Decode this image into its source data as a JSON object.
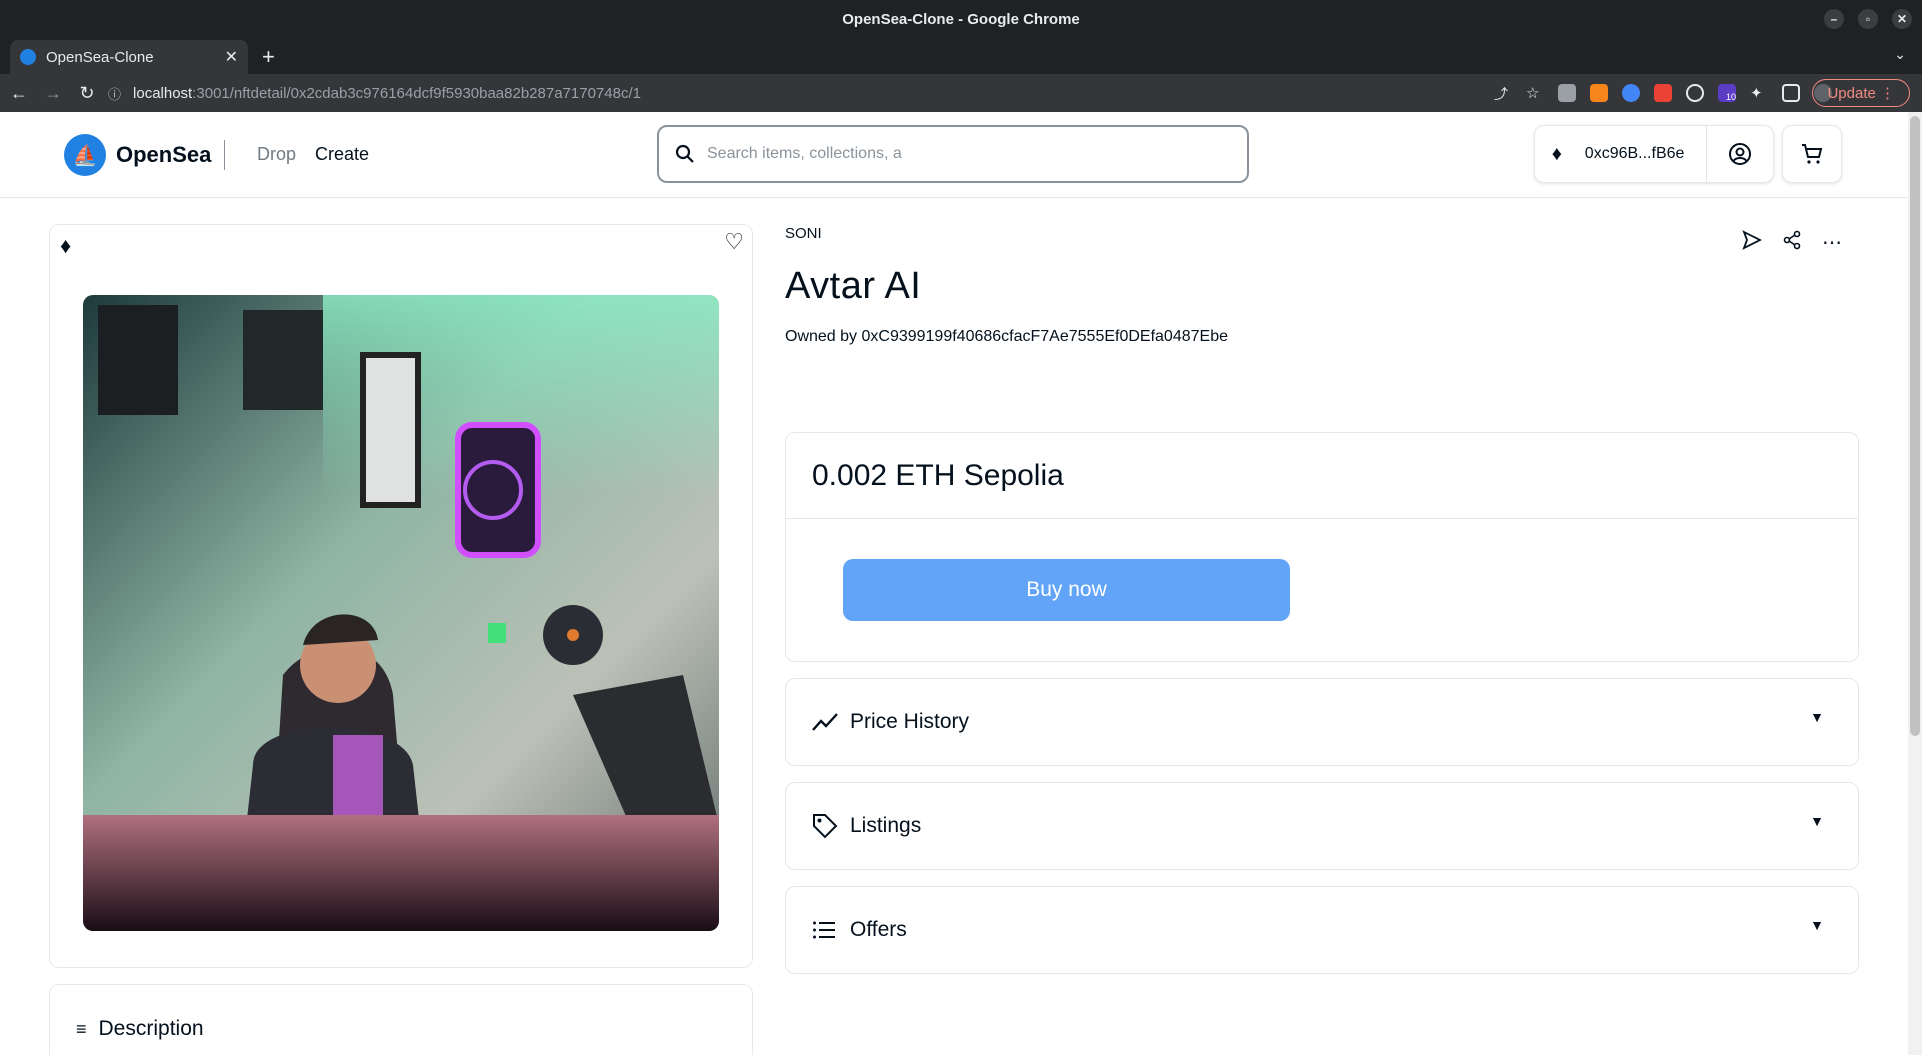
{
  "browser": {
    "window_title": "OpenSea-Clone - Google Chrome",
    "tab_title": "OpenSea-Clone",
    "url_host": "localhost",
    "url_path": ":3001/nftdetail/0x2cdab3c976164dcf9f5930baa82b287a7170748c/1",
    "update_label": "Update",
    "extension_badge": "10"
  },
  "header": {
    "logo_text": "OpenSea",
    "nav": {
      "drop": "Drop",
      "create": "Create"
    },
    "search_placeholder": "Search items, collections, a",
    "wallet_address": "0xc96B...fB6e"
  },
  "nft": {
    "collection": "SONI",
    "title": "Avtar AI",
    "owned_by": "Owned by 0xC9399199f40686cfacF7Ae7555Ef0DEfa0487Ebe",
    "price": "0.002 ETH Sepolia",
    "buy_label": "Buy now"
  },
  "sections": {
    "price_history": "Price History",
    "listings": "Listings",
    "offers": "Offers",
    "description": "Description"
  },
  "colors": {
    "accent": "#2081e2",
    "buy_button": "#62a4f8",
    "border": "#e5e8eb"
  }
}
